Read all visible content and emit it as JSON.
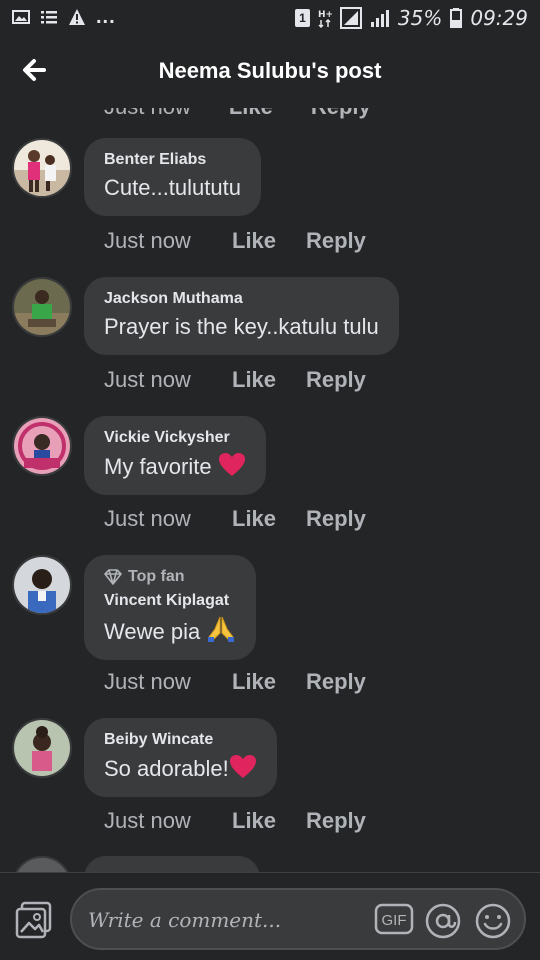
{
  "status_bar": {
    "dots": "...",
    "badge": "1",
    "battery": "35%",
    "time": "09:29"
  },
  "header": {
    "title": "Neema Sulubu's post"
  },
  "cut_actions": {
    "time": "Just now",
    "like": "Like",
    "reply": "Reply"
  },
  "comments": [
    {
      "author": "Benter Eliabs",
      "text": "Cute...tulututu",
      "time": "Just now",
      "like": "Like",
      "reply": "Reply"
    },
    {
      "author": "Jackson Muthama",
      "text": "Prayer is the key..katulu tulu",
      "time": "Just now",
      "like": "Like",
      "reply": "Reply"
    },
    {
      "author": "Vickie Vickysher",
      "text": "My favorite",
      "emoji": "heart-emoji",
      "time": "Just now",
      "like": "Like",
      "reply": "Reply"
    },
    {
      "badge": "Top fan",
      "author": "Vincent Kiplagat",
      "text": "Wewe pia",
      "emoji": "praying-hands-emoji",
      "time": "Just now",
      "like": "Like",
      "reply": "Reply"
    },
    {
      "author": "Beiby Wincate",
      "text": "So adorable!",
      "emoji": "heart-emoji",
      "time": "Just now",
      "like": "Like",
      "reply": "Reply"
    }
  ],
  "composer": {
    "placeholder": "Write a comment...",
    "gif_label": "GIF"
  },
  "colors": {
    "background": "#242526",
    "bubble": "#3a3b3c",
    "text_primary": "#e4e6eb",
    "text_secondary": "#b0b3b8",
    "heart": "#e0245e"
  }
}
